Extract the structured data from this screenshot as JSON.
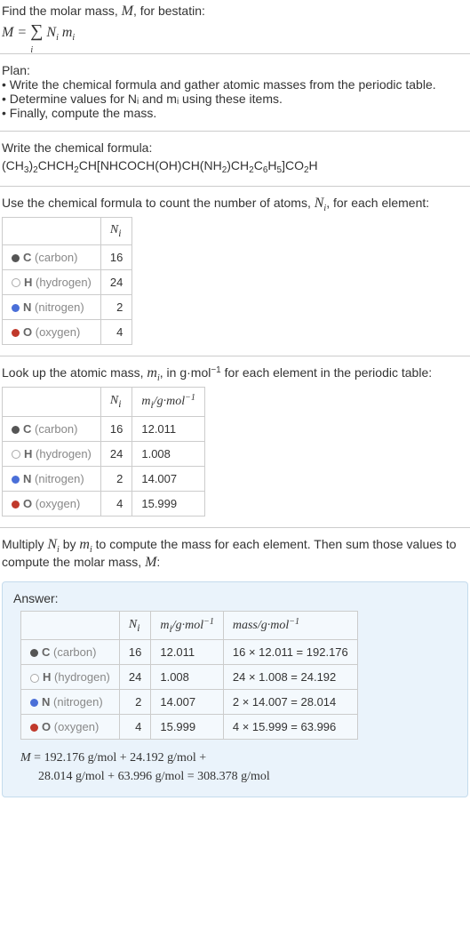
{
  "intro": {
    "line1": "Find the molar mass, M, for bestatin:",
    "formula_html": "M = ∑ N<sub>i</sub> m<sub>i</sub>",
    "sum_sub": "i"
  },
  "plan": {
    "heading": "Plan:",
    "items": [
      "• Write the chemical formula and gather atomic masses from the periodic table.",
      "• Determine values for Nᵢ and mᵢ using these items.",
      "• Finally, compute the mass."
    ]
  },
  "chem_formula": {
    "heading": "Write the chemical formula:",
    "formula": "(CH₃)₂CHCH₂CH[NHCOCH(OH)CH(NH₂)CH₂C₆H₅]CO₂H"
  },
  "count_text": "Use the chemical formula to count the number of atoms, Nᵢ, for each element:",
  "table1": {
    "header_ni": "Nᵢ",
    "rows": [
      {
        "dot": "c",
        "sym": "C",
        "name": "(carbon)",
        "ni": "16"
      },
      {
        "dot": "h",
        "sym": "H",
        "name": "(hydrogen)",
        "ni": "24"
      },
      {
        "dot": "n",
        "sym": "N",
        "name": "(nitrogen)",
        "ni": "2"
      },
      {
        "dot": "o",
        "sym": "O",
        "name": "(oxygen)",
        "ni": "4"
      }
    ]
  },
  "lookup_text": "Look up the atomic mass, mᵢ, in g·mol⁻¹ for each element in the periodic table:",
  "table2": {
    "header_ni": "Nᵢ",
    "header_mi": "mᵢ/g·mol⁻¹",
    "rows": [
      {
        "dot": "c",
        "sym": "C",
        "name": "(carbon)",
        "ni": "16",
        "mi": "12.011"
      },
      {
        "dot": "h",
        "sym": "H",
        "name": "(hydrogen)",
        "ni": "24",
        "mi": "1.008"
      },
      {
        "dot": "n",
        "sym": "N",
        "name": "(nitrogen)",
        "ni": "2",
        "mi": "14.007"
      },
      {
        "dot": "o",
        "sym": "O",
        "name": "(oxygen)",
        "ni": "4",
        "mi": "15.999"
      }
    ]
  },
  "multiply_text": "Multiply Nᵢ by mᵢ to compute the mass for each element. Then sum those values to compute the molar mass, M:",
  "answer": {
    "label": "Answer:",
    "table": {
      "header_ni": "Nᵢ",
      "header_mi": "mᵢ/g·mol⁻¹",
      "header_mass": "mass/g·mol⁻¹",
      "rows": [
        {
          "dot": "c",
          "sym": "C",
          "name": "(carbon)",
          "ni": "16",
          "mi": "12.011",
          "mass": "16 × 12.011 = 192.176"
        },
        {
          "dot": "h",
          "sym": "H",
          "name": "(hydrogen)",
          "ni": "24",
          "mi": "1.008",
          "mass": "24 × 1.008 = 24.192"
        },
        {
          "dot": "n",
          "sym": "N",
          "name": "(nitrogen)",
          "ni": "2",
          "mi": "14.007",
          "mass": "2 × 14.007 = 28.014"
        },
        {
          "dot": "o",
          "sym": "O",
          "name": "(oxygen)",
          "ni": "4",
          "mi": "15.999",
          "mass": "4 × 15.999 = 63.996"
        }
      ]
    },
    "sum_line1": "M = 192.176 g/mol + 24.192 g/mol +",
    "sum_line2": "28.014 g/mol + 63.996 g/mol = 308.378 g/mol"
  }
}
